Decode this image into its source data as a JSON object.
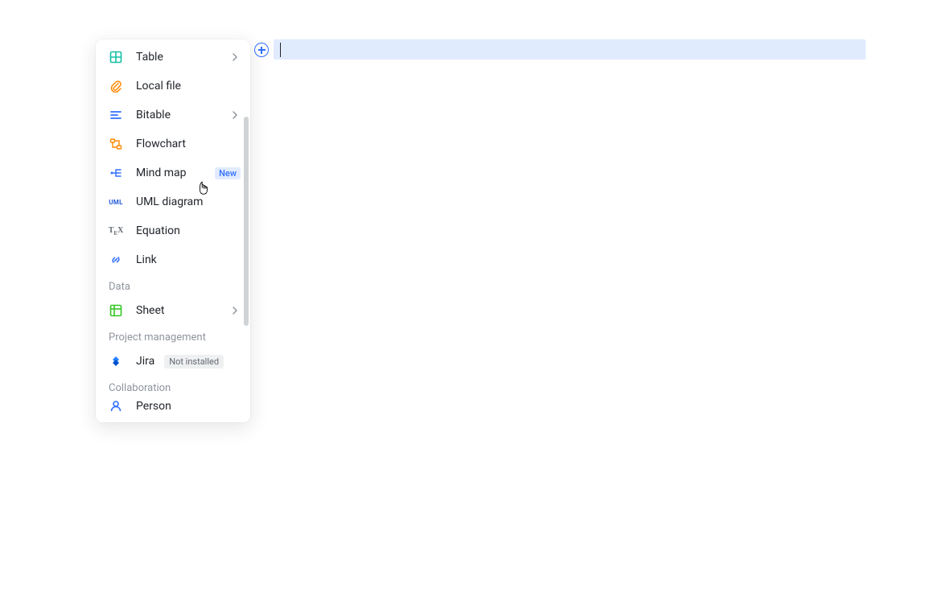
{
  "menu": {
    "items_group1": [
      {
        "id": "table",
        "label": "Table",
        "icon": "table-icon",
        "has_submenu": true
      },
      {
        "id": "local-file",
        "label": "Local file",
        "icon": "attachment-icon"
      },
      {
        "id": "bitable",
        "label": "Bitable",
        "icon": "bitable-icon",
        "has_submenu": true
      },
      {
        "id": "flowchart",
        "label": "Flowchart",
        "icon": "flowchart-icon"
      },
      {
        "id": "mind-map",
        "label": "Mind map",
        "icon": "mindmap-icon",
        "badge": "New"
      },
      {
        "id": "uml-diagram",
        "label": "UML diagram",
        "icon": "uml-icon"
      },
      {
        "id": "equation",
        "label": "Equation",
        "icon": "tex-icon"
      },
      {
        "id": "link",
        "label": "Link",
        "icon": "link-icon"
      }
    ],
    "section_data": "Data",
    "items_data": [
      {
        "id": "sheet",
        "label": "Sheet",
        "icon": "sheet-icon",
        "has_submenu": true
      }
    ],
    "section_project": "Project management",
    "items_project": [
      {
        "id": "jira",
        "label": "Jira",
        "icon": "jira-icon",
        "badge_gray": "Not installed"
      }
    ],
    "section_collab": "Collaboration",
    "items_collab": [
      {
        "id": "person",
        "label": "Person",
        "icon": "person-icon"
      }
    ]
  }
}
